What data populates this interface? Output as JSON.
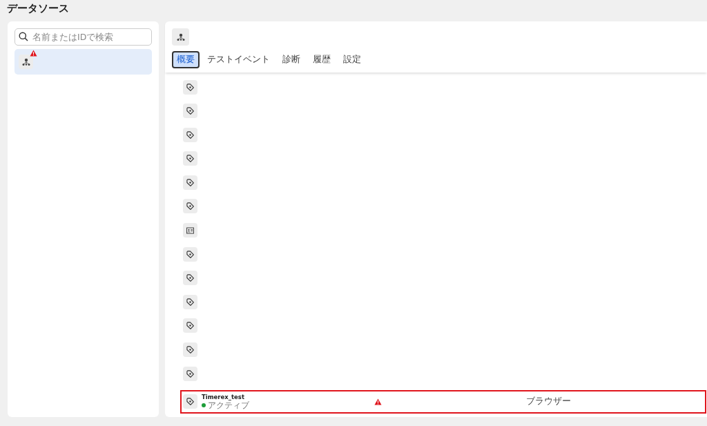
{
  "page_title": "データソース",
  "search": {
    "placeholder": "名前またはIDで検索"
  },
  "sources": [
    {
      "kind": "pixel",
      "warning": true,
      "selected": true
    }
  ],
  "detail": {
    "kind": "pixel"
  },
  "tabs": [
    {
      "label": "概要",
      "selected": true
    },
    {
      "label": "テストイベント",
      "selected": false
    },
    {
      "label": "診断",
      "selected": false
    },
    {
      "label": "履歴",
      "selected": false
    },
    {
      "label": "設定",
      "selected": false
    }
  ],
  "rows": [
    {
      "kind": "tag"
    },
    {
      "kind": "tag"
    },
    {
      "kind": "tag"
    },
    {
      "kind": "tag"
    },
    {
      "kind": "tag"
    },
    {
      "kind": "tag"
    },
    {
      "kind": "card"
    },
    {
      "kind": "tag"
    },
    {
      "kind": "tag"
    },
    {
      "kind": "tag"
    },
    {
      "kind": "tag"
    },
    {
      "kind": "tag"
    },
    {
      "kind": "tag"
    },
    {
      "kind": "tag",
      "name": "Timerex_test",
      "status": "アクティブ",
      "color": "#1e9e3a",
      "warning": true,
      "type": "ブラウザー",
      "highlighted": true
    }
  ]
}
